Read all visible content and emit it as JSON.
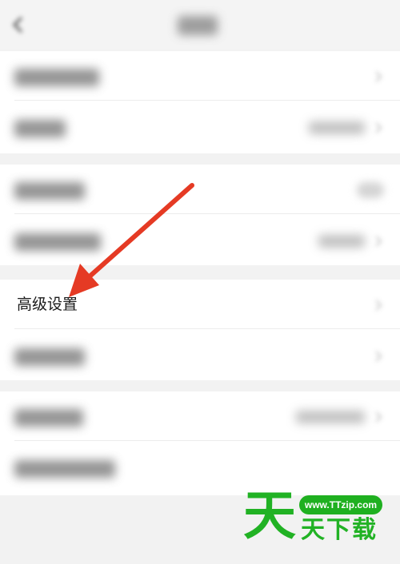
{
  "advanced_settings_label": "高级设置",
  "watermark": {
    "url": "www.TTzip.com",
    "big_char": "天",
    "text": "天下载"
  },
  "colors": {
    "arrow": "#e53a24",
    "watermark": "#21b224",
    "background": "#f2f2f2",
    "row": "#ffffff"
  },
  "icons": {
    "back": "back-arrow-icon",
    "chevron": "chevron-right-icon"
  }
}
